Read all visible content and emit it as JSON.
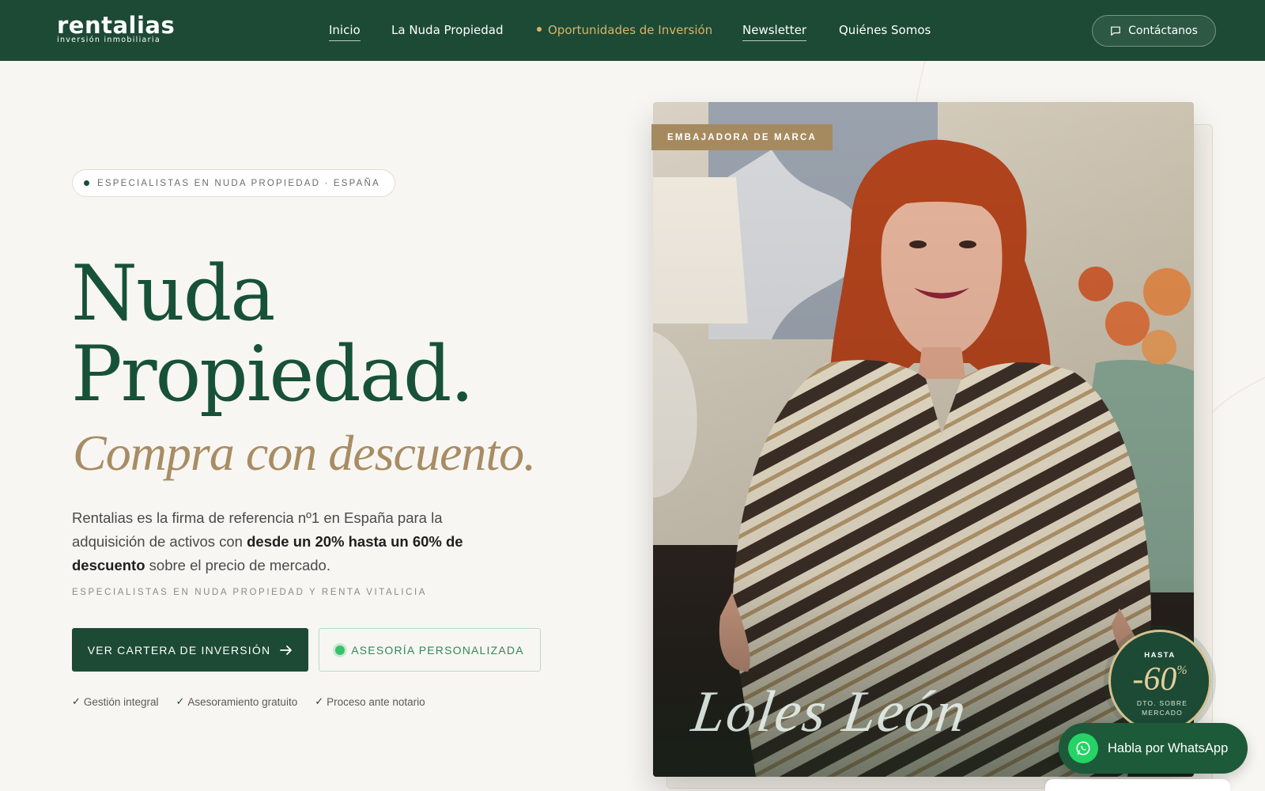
{
  "brand": {
    "name": "rentalias",
    "tagline": "inversión inmobiliaria"
  },
  "nav": {
    "items": [
      {
        "label": "Inicio"
      },
      {
        "label": "La Nuda Propiedad"
      },
      {
        "label": "Oportunidades de Inversión"
      },
      {
        "label": "Newsletter"
      },
      {
        "label": "Quiénes Somos"
      }
    ],
    "contact_label": "Contáctanos"
  },
  "hero": {
    "badge": "ESPECIALISTAS EN NUDA PROPIEDAD · ESPAÑA",
    "title_line1": "Nuda",
    "title_line2": "Propiedad.",
    "subtitle": "Compra con descuento.",
    "description_part1": "Rentalias es la firma de referencia nº1 en España para la adquisición de activos con ",
    "description_highlight": "desde un 20% hasta un 60% de descuento",
    "description_part2": " sobre el precio de mercado.",
    "tagline": "ESPECIALISTAS EN NUDA PROPIEDAD Y RENTA VITALICIA",
    "primary_cta": "VER CARTERA DE INVERSIÓN",
    "secondary_cta": "ASESORÍA PERSONALIZADA",
    "checks": [
      "Gestión integral",
      "Asesoramiento gratuito",
      "Proceso ante notario"
    ]
  },
  "ambassador": {
    "label": "EMBAJADORA DE MARCA",
    "signature": "Loles León"
  },
  "discount_badge": {
    "top": "HASTA",
    "value": "-60",
    "unit": "%",
    "bottom": "DTO. SOBRE MERCADO"
  },
  "whatsapp": {
    "label": "Habla por WhatsApp"
  },
  "colors": {
    "brand_green": "#1c4a35",
    "accent_gold": "#d9b36b",
    "subtitle_tan": "#a88c64",
    "background": "#f8f6f2"
  }
}
